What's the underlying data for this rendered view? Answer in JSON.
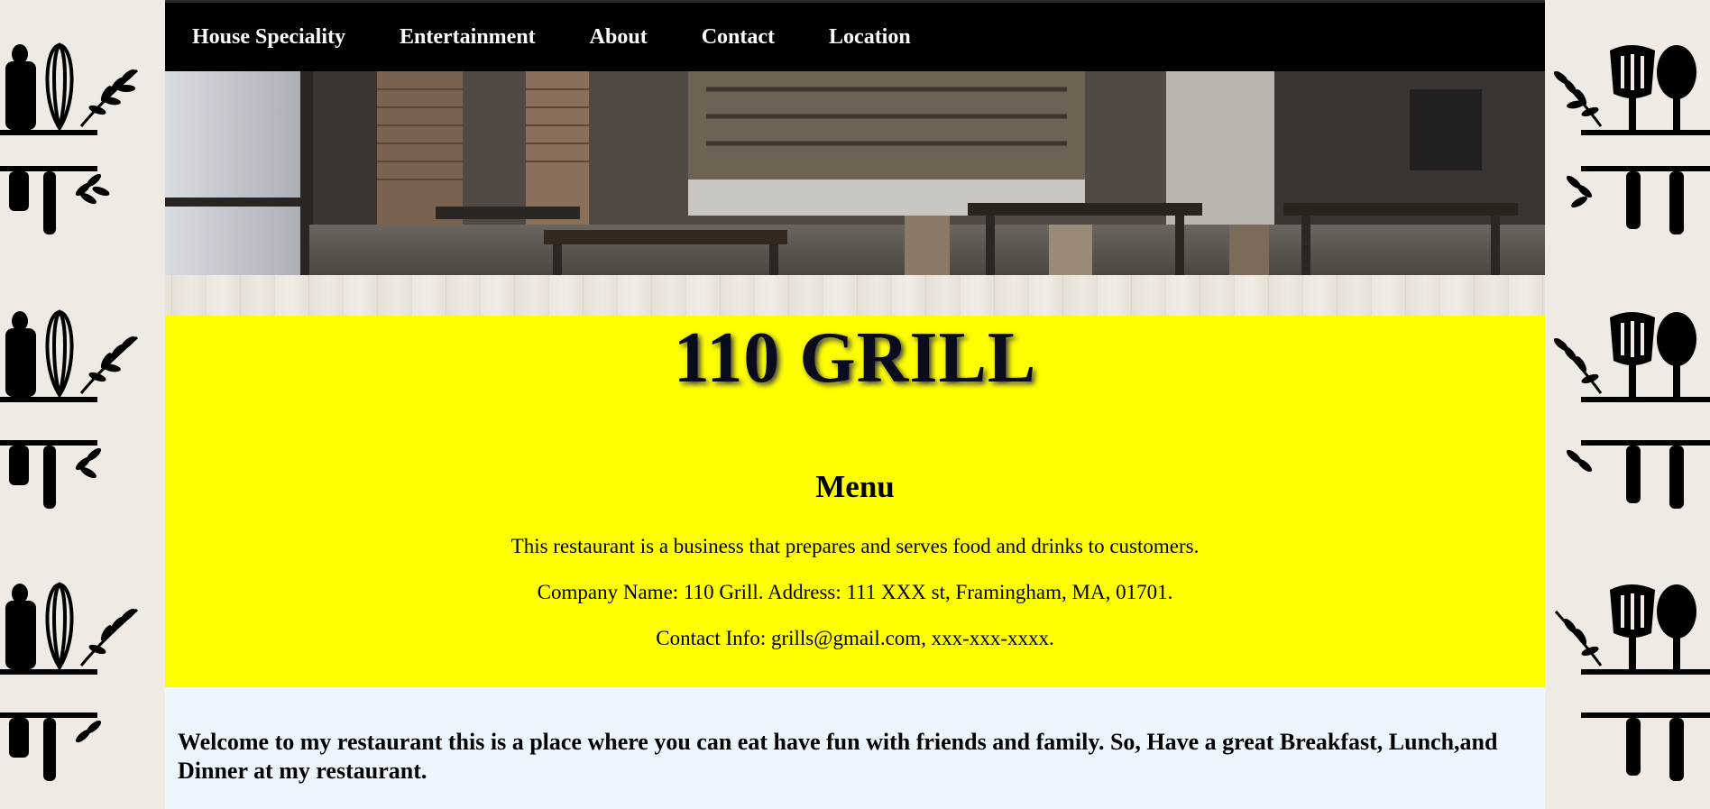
{
  "nav": {
    "items": [
      {
        "label": "House Speciality"
      },
      {
        "label": "Entertainment"
      },
      {
        "label": "About"
      },
      {
        "label": "Contact"
      },
      {
        "label": "Location"
      }
    ]
  },
  "hero": {
    "image": "restaurant-interior-photo"
  },
  "header": {
    "title": "110 GRILL"
  },
  "menu": {
    "heading": "Menu",
    "description": "This restaurant is a business that prepares and serves food and drinks to customers.",
    "company": "Company Name: 110 Grill. Address: 111 XXX st, Framingham, MA, 01701.",
    "contact": "Contact Info: grills@gmail.com, xxx-xxx-xxxx."
  },
  "welcome": {
    "text": "Welcome to my restaurant this is a place where you can eat have fun with friends and family. So, Have a great Breakfast, Lunch,and Dinner at my restaurant."
  },
  "colors": {
    "nav_background": "#000000",
    "banner_background": "#ffff00",
    "welcome_background": "#eef6fd",
    "title_color": "#0b0b1e"
  },
  "decorations": {
    "left_tile_icons": [
      "rolling-pin-icon",
      "whisk-icon",
      "olive-branch-icon"
    ],
    "right_tile_icons": [
      "olive-branch-icon",
      "slotted-spatula-icon",
      "spoon-icon"
    ]
  }
}
